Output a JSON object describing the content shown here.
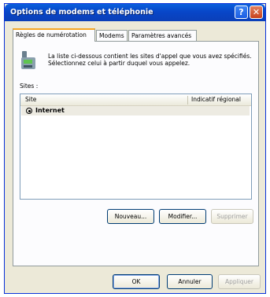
{
  "window": {
    "title": "Options de modems et téléphonie"
  },
  "titlebar": {
    "help_glyph": "?",
    "close_glyph": "✕"
  },
  "tabs": [
    {
      "label": "Règles de numérotation"
    },
    {
      "label": "Modems"
    },
    {
      "label": "Paramètres avancés"
    }
  ],
  "panel": {
    "description": "La liste ci-dessous contient les sites d'appel que vous avez spécifiés. Sélectionnez celui à partir duquel vous appelez.",
    "sites_label": "Sites :",
    "list": {
      "columns": [
        "Site",
        "Indicatif régional"
      ],
      "rows": [
        {
          "site": "Internet",
          "area_code": ""
        }
      ]
    },
    "buttons": {
      "new": "Nouveau...",
      "modify": "Modifier...",
      "delete": "Supprimer"
    }
  },
  "footer": {
    "ok": "OK",
    "cancel": "Annuler",
    "apply": "Appliquer"
  },
  "colors": {
    "titlebar": "#0a4fd0",
    "accent_tab": "#f5a623",
    "dialog_bg": "#ece9d8"
  }
}
